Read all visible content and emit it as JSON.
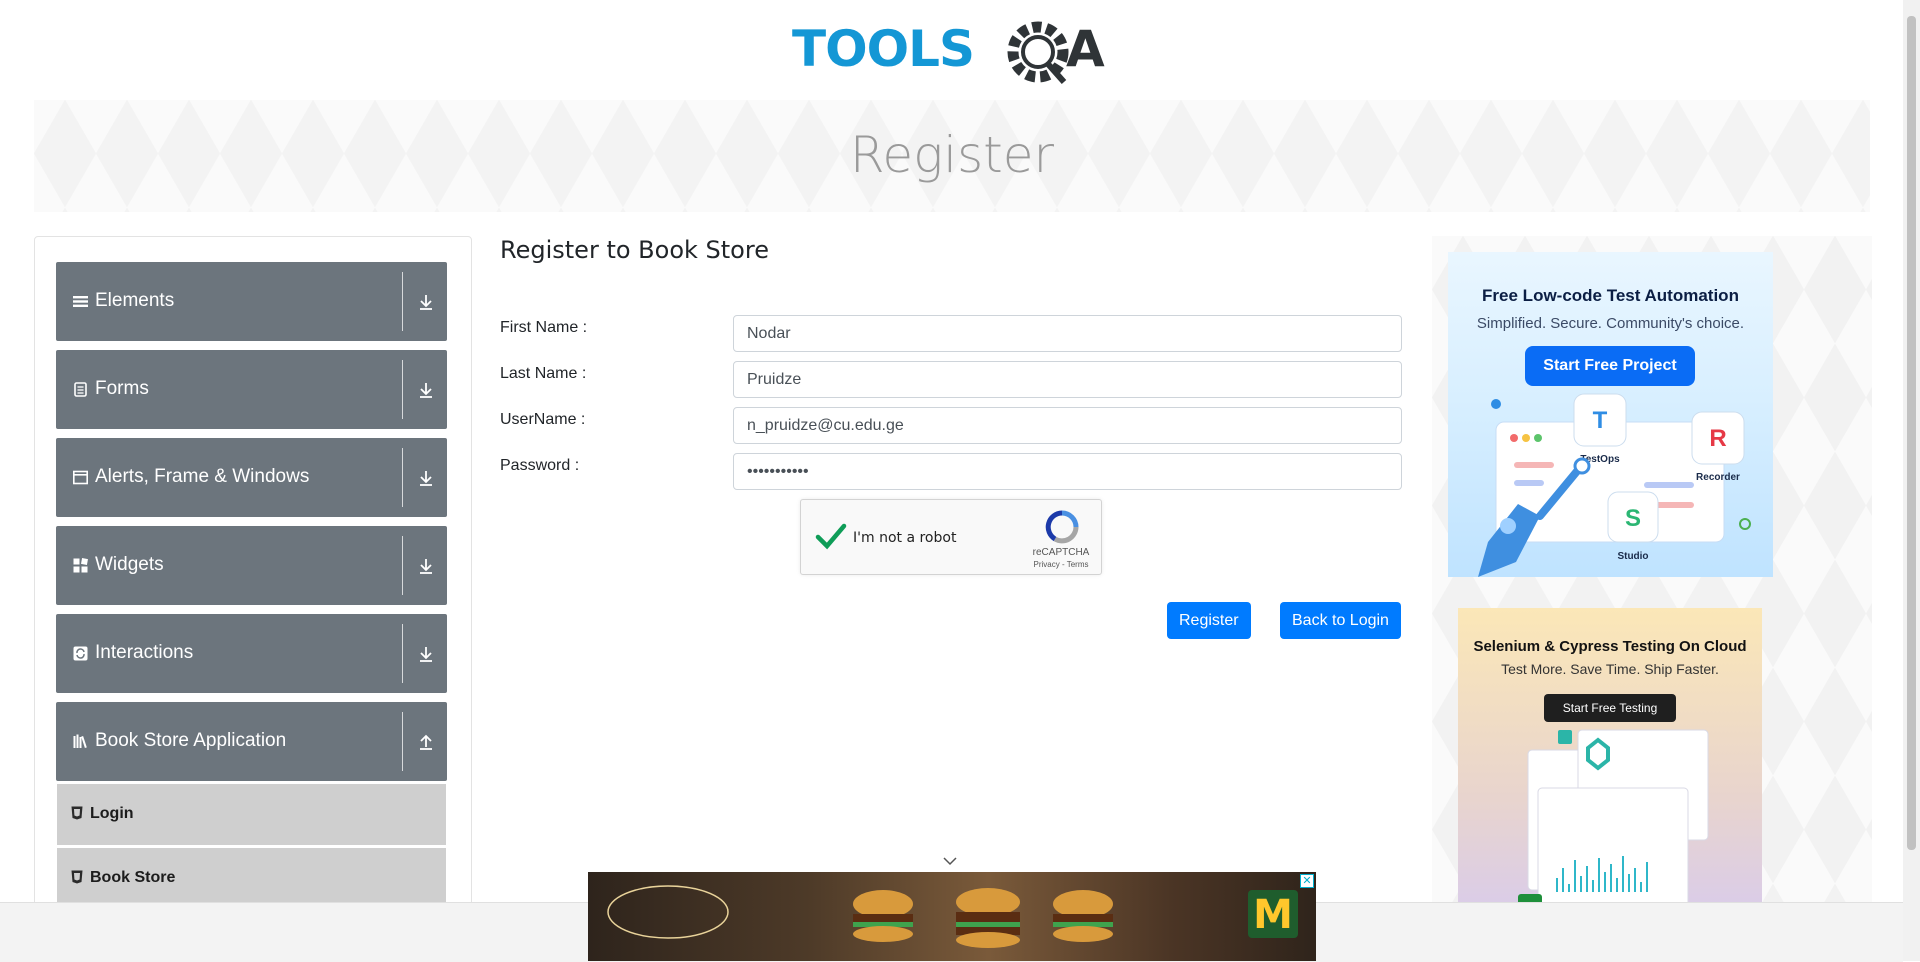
{
  "brand": {
    "logo_text": "TOOLSQA"
  },
  "banner": {
    "title": "Register"
  },
  "sidebar": {
    "groups": [
      {
        "label": "Elements",
        "icon": "list-icon"
      },
      {
        "label": "Forms",
        "icon": "form-icon"
      },
      {
        "label": "Alerts, Frame & Windows",
        "icon": "window-icon"
      },
      {
        "label": "Widgets",
        "icon": "widgets-icon"
      },
      {
        "label": "Interactions",
        "icon": "interactions-icon"
      },
      {
        "label": "Book Store Application",
        "icon": "books-icon"
      }
    ],
    "subitems": [
      {
        "label": "Login"
      },
      {
        "label": "Book Store"
      }
    ]
  },
  "form": {
    "title": "Register to Book Store",
    "first_name": {
      "label": "First Name :",
      "value": "Nodar"
    },
    "last_name": {
      "label": "Last Name :",
      "value": "Pruidze"
    },
    "username": {
      "label": "UserName :",
      "value": "n_pruidze@cu.edu.ge"
    },
    "password": {
      "label": "Password :",
      "value": "•••••••••••"
    },
    "captcha": {
      "label": "I'm not a robot",
      "brand": "reCAPTCHA",
      "links": "Privacy - Terms",
      "checked": true
    },
    "register_button": "Register",
    "back_button": "Back to Login"
  },
  "ads": {
    "ad1": {
      "title": "Free Low-code Test Automation",
      "subtitle": "Simplified. Secure. Community's choice.",
      "cta": "Start Free Project",
      "labels": [
        "TestOps",
        "Recorder",
        "Studio"
      ]
    },
    "ad2": {
      "title": "Selenium & Cypress Testing On Cloud",
      "subtitle": "Test More. Save Time. Ship Faster.",
      "cta": "Start Free Testing"
    }
  },
  "bottom_ad": {
    "close": "✕"
  },
  "colors": {
    "primary": "#007bff",
    "sidebar_group": "#6c757d",
    "subitem": "#cfcfcf",
    "logo_blue": "#1497d5"
  }
}
